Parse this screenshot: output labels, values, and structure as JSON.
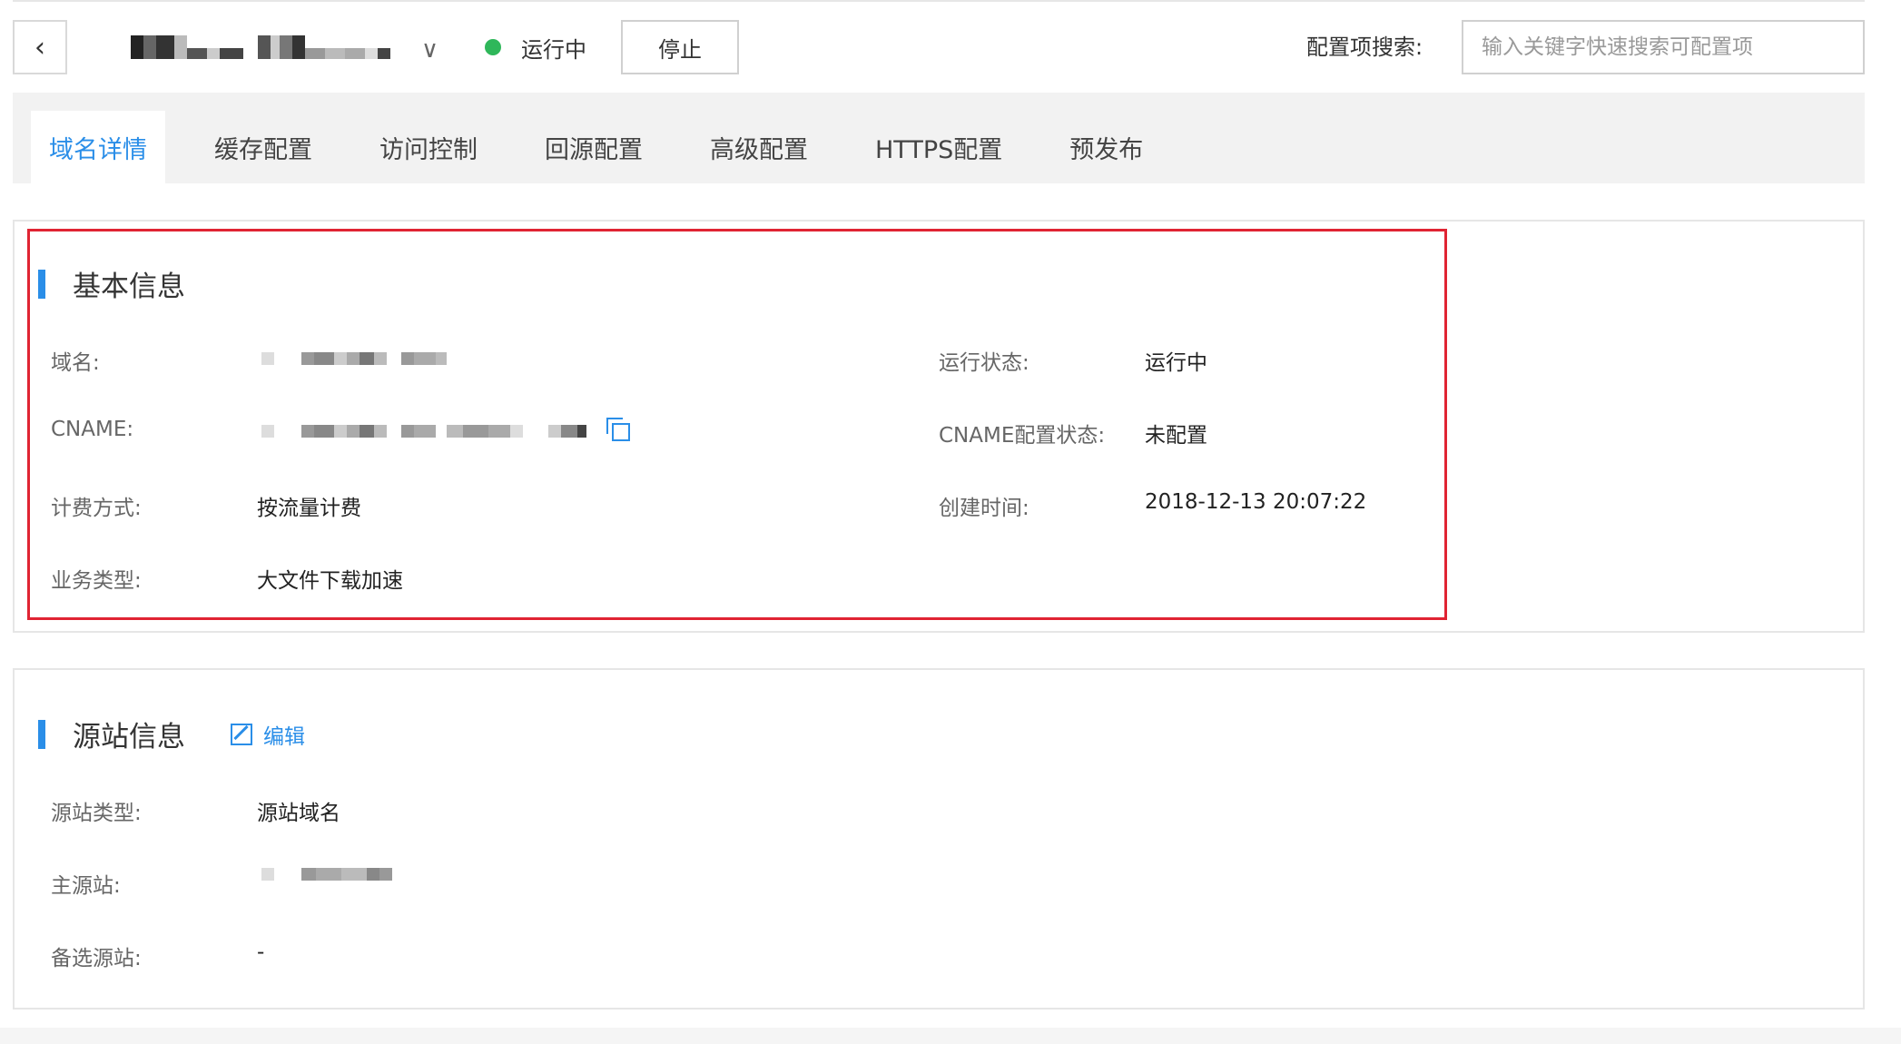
{
  "header": {
    "back_icon": "chevron-left-icon",
    "domain_dropdown_icon": "chevron-down-icon",
    "status_text": "运行中",
    "status_color": "#2fb75a",
    "stop_label": "停止",
    "search_label": "配置项搜索:",
    "search_placeholder": "输入关键字快速搜索可配置项"
  },
  "tabs": [
    {
      "label": "域名详情",
      "active": true
    },
    {
      "label": "缓存配置",
      "active": false
    },
    {
      "label": "访问控制",
      "active": false
    },
    {
      "label": "回源配置",
      "active": false
    },
    {
      "label": "高级配置",
      "active": false
    },
    {
      "label": "HTTPS配置",
      "active": false
    },
    {
      "label": "预发布",
      "active": false
    }
  ],
  "basic_info": {
    "title": "基本信息",
    "domain_label": "域名:",
    "cname_label": "CNAME:",
    "billing_label": "计费方式:",
    "billing_value": "按流量计费",
    "business_label": "业务类型:",
    "business_value": "大文件下载加速",
    "run_status_label": "运行状态:",
    "run_status_value": "运行中",
    "cname_status_label": "CNAME配置状态:",
    "cname_status_value": "未配置",
    "created_label": "创建时间:",
    "created_value": "2018-12-13 20:07:22",
    "copy_icon": "copy-icon"
  },
  "origin_info": {
    "title": "源站信息",
    "edit_label": "编辑",
    "edit_icon": "edit-icon",
    "origin_type_label": "源站类型:",
    "origin_type_value": "源站域名",
    "primary_label": "主源站:",
    "backup_label": "备选源站:",
    "backup_value": "-"
  },
  "colors": {
    "accent": "#2a8ee8",
    "highlight_border": "#e02433"
  }
}
